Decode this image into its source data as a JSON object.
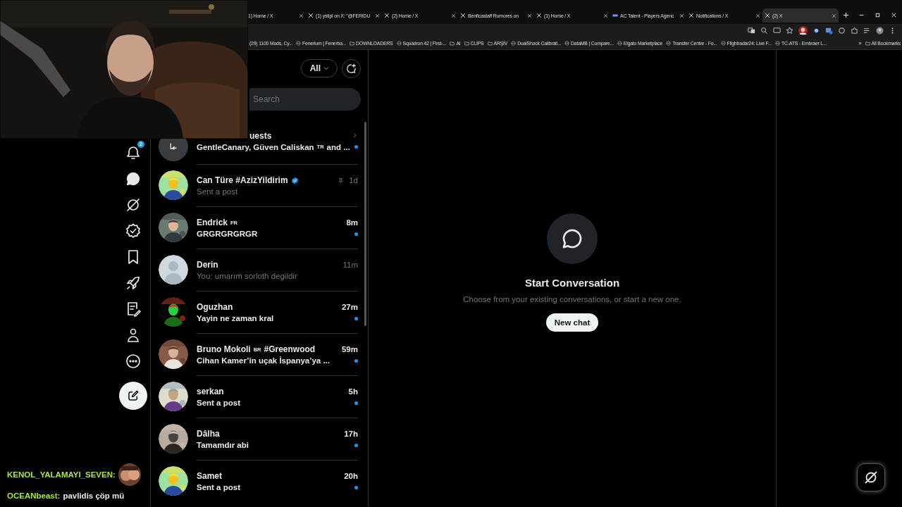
{
  "browser": {
    "tabs": [
      {
        "title": "1) Home / X",
        "kind": "plain",
        "selected": false
      },
      {
        "title": "(1) ystipl on X: \"@FERIDU",
        "kind": "x",
        "selected": false
      },
      {
        "title": "(2) Home / X",
        "kind": "x",
        "selected": false
      },
      {
        "title": "Benficastaff Rumores on",
        "kind": "x",
        "selected": false
      },
      {
        "title": "(1) Home / X",
        "kind": "x",
        "selected": false
      },
      {
        "title": "AC Talent - Players Agenc",
        "kind": "flag",
        "selected": false
      },
      {
        "title": "Notifications / X",
        "kind": "x",
        "selected": false
      },
      {
        "title": "(2) X",
        "kind": "x",
        "selected": true
      }
    ],
    "bookmarks": [
      {
        "label": "(29) 1100 Mods, Cy...",
        "kind": "none"
      },
      {
        "label": "Fenerium | Fenerba...",
        "kind": "page"
      },
      {
        "label": "DOWNLOADERS",
        "kind": "folder"
      },
      {
        "label": "Squadron 42 | First-...",
        "kind": "page"
      },
      {
        "label": "AI",
        "kind": "folder"
      },
      {
        "label": "CLIPS",
        "kind": "folder"
      },
      {
        "label": "ARŞİV",
        "kind": "folder"
      },
      {
        "label": "DualShock Calibrati...",
        "kind": "page"
      },
      {
        "label": "DataMB | Compare...",
        "kind": "page"
      },
      {
        "label": "Elgato Marketplace",
        "kind": "page"
      },
      {
        "label": "Transfer Centre - Fo...",
        "kind": "page"
      },
      {
        "label": "Flightradar24: Live F...",
        "kind": "page"
      },
      {
        "label": "TC-ATS - Embraer L...",
        "kind": "page"
      }
    ],
    "overflow": "»",
    "all_bookmarks": "All Bookmarks"
  },
  "nav": [
    {
      "kind": "notifications",
      "badge": "2",
      "selected": false
    },
    {
      "kind": "messages",
      "selected": true
    },
    {
      "kind": "grok",
      "selected": false
    },
    {
      "kind": "verified",
      "selected": false
    },
    {
      "kind": "bookmarks",
      "selected": false
    },
    {
      "kind": "rocket",
      "selected": false
    },
    {
      "kind": "articles",
      "selected": false
    },
    {
      "kind": "profile",
      "selected": false
    },
    {
      "kind": "more",
      "selected": false
    }
  ],
  "messages": {
    "filter": "All",
    "search": {
      "placeholder": "Search"
    },
    "requests": {
      "title": "uests",
      "preview": "GentleCanary, Güven Caliskan",
      "flag": "TR",
      "preview_end": "and ...",
      "unread": true
    },
    "conversations": [
      {
        "name": "Can Türe #AzizYildirim",
        "verified": true,
        "pinned": true,
        "time": "1d",
        "preview": "Sent a post",
        "unread": false,
        "kind": "picture"
      },
      {
        "name": "Endrick",
        "flag": "FR",
        "time": "8m",
        "preview": "GRGRGRGRGR",
        "unread": true,
        "kind": "picture"
      },
      {
        "name": "Derin",
        "time": "11m",
        "preview": "You: umarım sorloth degildir",
        "unread": false,
        "kind": "default"
      },
      {
        "name": "Oguzhan",
        "time": "27m",
        "preview": "Yayin ne zaman kral",
        "unread": true,
        "kind": "picture"
      },
      {
        "name": "Bruno Mokoli",
        "flag": "BR",
        "name_suffix": "#Greenwood",
        "time": "59m",
        "preview": "Cihan Kamer’in uçak İspanya’ya ...",
        "unread": true,
        "kind": "picture"
      },
      {
        "name": "serkan",
        "time": "5h",
        "preview": "Sent a post",
        "unread": true,
        "kind": "picture"
      },
      {
        "name": "Dâlha",
        "time": "17h",
        "preview": "Tamamdır abi",
        "unread": true,
        "kind": "picture"
      },
      {
        "name": "Samet",
        "time": "20h",
        "preview": "Sent a post",
        "unread": true,
        "kind": "picture"
      }
    ]
  },
  "empty_state": {
    "title": "Start Conversation",
    "text": "Choose from your existing conversations, or start a new one.",
    "button": "New chat"
  },
  "stream_chat": [
    {
      "user": "KENOL_YALAMAYI_SEVEN:",
      "kind": "emote"
    },
    {
      "user": "OCEANbeast:",
      "message": "pavlidis çöp mü",
      "kind": "text"
    }
  ]
}
